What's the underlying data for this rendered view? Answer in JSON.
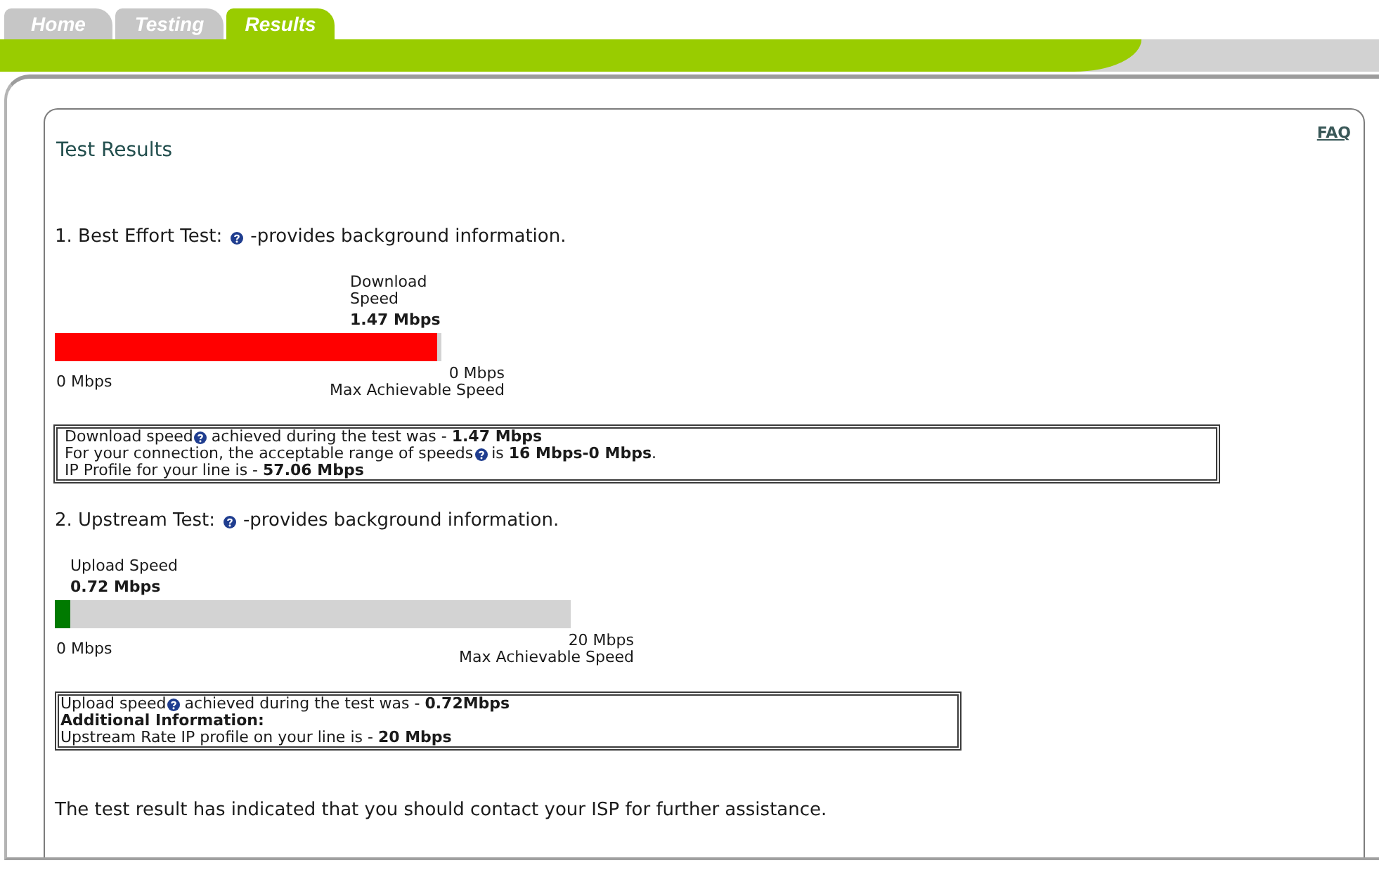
{
  "tabs": [
    {
      "label": "Home",
      "selected": false
    },
    {
      "label": "Testing",
      "selected": false
    },
    {
      "label": "Results",
      "selected": true
    }
  ],
  "panel": {
    "title": "Test Results",
    "faq_link": "FAQ"
  },
  "tests": [
    {
      "heading": "1. Best Effort Test:",
      "note": "-provides background information.",
      "meter": {
        "label": "Download Speed",
        "value": "1.47 Mbps",
        "level": 0.99,
        "color": "#ff0000",
        "min_label": "0 Mbps",
        "max_label": "0 Mbps",
        "max_caption": "Max Achievable Speed"
      },
      "details": [
        {
          "kind": "help",
          "text": "Download speed",
          "text_after": "achieved during the test was - **1.47 Mbps**"
        },
        {
          "kind": "help",
          "text": "For your connection, the acceptable range of speeds",
          "text_after": "is **16 Mbps-0 Mbps**."
        },
        {
          "kind": "plain",
          "text": "IP Profile for your line is - **57.06 Mbps**"
        }
      ]
    },
    {
      "heading": "2. Upstream Test:",
      "note": "-provides background information.",
      "meter": {
        "label": "Upload Speed",
        "value": "0.72 Mbps",
        "level": 0.03,
        "color": "#007a00",
        "min_label": "0 Mbps",
        "max_label": "20 Mbps",
        "max_caption": "Max Achievable Speed"
      },
      "details": [
        {
          "kind": "help",
          "text": "Upload speed",
          "text_after": "achieved during the test was - **0.72Mbps**"
        },
        {
          "kind": "heading",
          "text": "Additional Information:"
        },
        {
          "kind": "plain",
          "text": "Upstream Rate IP profile on your line is - **20 Mbps**"
        }
      ]
    }
  ],
  "conclusion": "The test result has indicated that you should contact your ISP for further assistance."
}
